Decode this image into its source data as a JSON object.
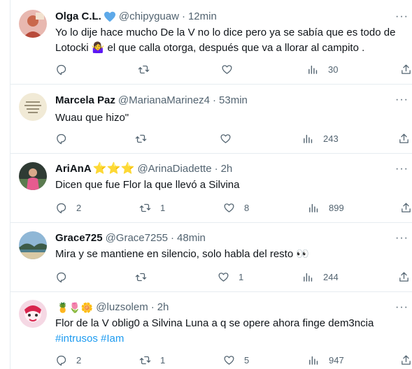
{
  "tweets": [
    {
      "name": "Olga C.L.",
      "handle": "@chipyguaw",
      "time": "12min",
      "text": "Yo lo dije hace mucho De la V no lo dice pero ya se sabía que es todo de Lotocki 🤷‍♀️ el que calla otorga, después que va a llorar al campito .",
      "replies": "",
      "retweets": "",
      "likes": "",
      "views": "30"
    },
    {
      "name": "Marcela Paz",
      "handle": "@MarianaMarinez4",
      "time": "53min",
      "text": "Wuau que hizo\"",
      "replies": "",
      "retweets": "",
      "likes": "",
      "views": "243"
    },
    {
      "name": "AriAnA",
      "name_suffix": "⭐⭐⭐",
      "handle": "@ArinaDiadette",
      "time": "2h",
      "text": "Dicen que fue Flor la que llevó a Silvina",
      "replies": "2",
      "retweets": "1",
      "likes": "8",
      "views": "899"
    },
    {
      "name": "Grace725",
      "handle": "@Grace7255",
      "time": "48min",
      "text": "Mira y se mantiene en silencio, solo habla del resto 👀",
      "replies": "",
      "retweets": "",
      "likes": "1",
      "views": "244"
    },
    {
      "name": "🍍🌷🌼",
      "handle": "@luzsolem",
      "time": "2h",
      "text": "Flor de la V oblig0 a Silvina Luna a q se opere ahora finge dem3ncia",
      "hashtags": "#intrusos #Iam",
      "replies": "2",
      "retweets": "1",
      "likes": "5",
      "views": "947"
    }
  ],
  "more_symbol": "···",
  "dot_separator": "·",
  "colors": {
    "text": "#0f1419",
    "secondary": "#536471",
    "link": "#1d9bf0",
    "verified": "#1d9bf0",
    "divider": "#e6ecf0"
  }
}
